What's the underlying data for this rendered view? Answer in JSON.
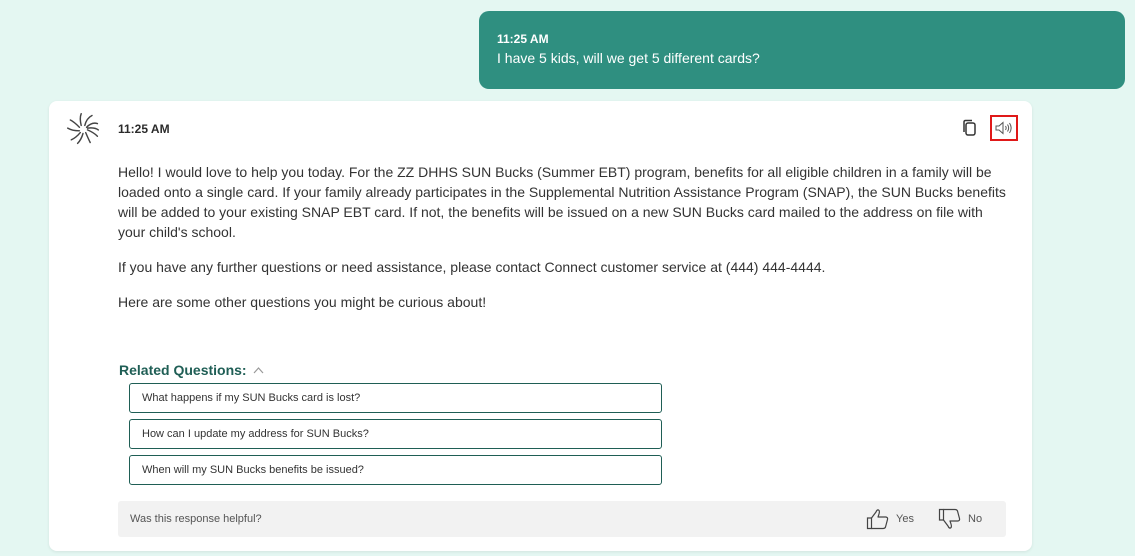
{
  "user_message": {
    "time": "11:25 AM",
    "text": "I have 5 kids, will we get 5 different cards?"
  },
  "bot_message": {
    "time": "11:25 AM",
    "paragraphs": [
      "Hello! I would love to help you today. For the ZZ DHHS SUN Bucks (Summer EBT) program, benefits for all eligible children in a family will be loaded onto a single card. If your family already participates in the Supplemental Nutrition Assistance Program (SNAP), the SUN Bucks benefits will be added to your existing SNAP EBT card. If not, the benefits will be issued on a new SUN Bucks card mailed to the address on file with your child's school.",
      "If you have any further questions or need assistance, please contact Connect customer service at (444) 444-4444.",
      "Here are some other questions you might be curious about!"
    ],
    "icons": {
      "copy": "copy-icon",
      "speaker": "speaker-icon"
    }
  },
  "related_questions": {
    "heading": "Related Questions:",
    "items": [
      "What happens if my SUN Bucks card is lost?",
      "How can I update my address for SUN Bucks?",
      "When will my SUN Bucks benefits be issued?"
    ]
  },
  "feedback": {
    "prompt": "Was this response helpful?",
    "yes_label": "Yes",
    "no_label": "No"
  },
  "colors": {
    "page_background": "#e4f7f2",
    "user_bubble": "#2f8f80",
    "accent_dark": "#1f5e55",
    "highlight_border": "#e01919"
  }
}
